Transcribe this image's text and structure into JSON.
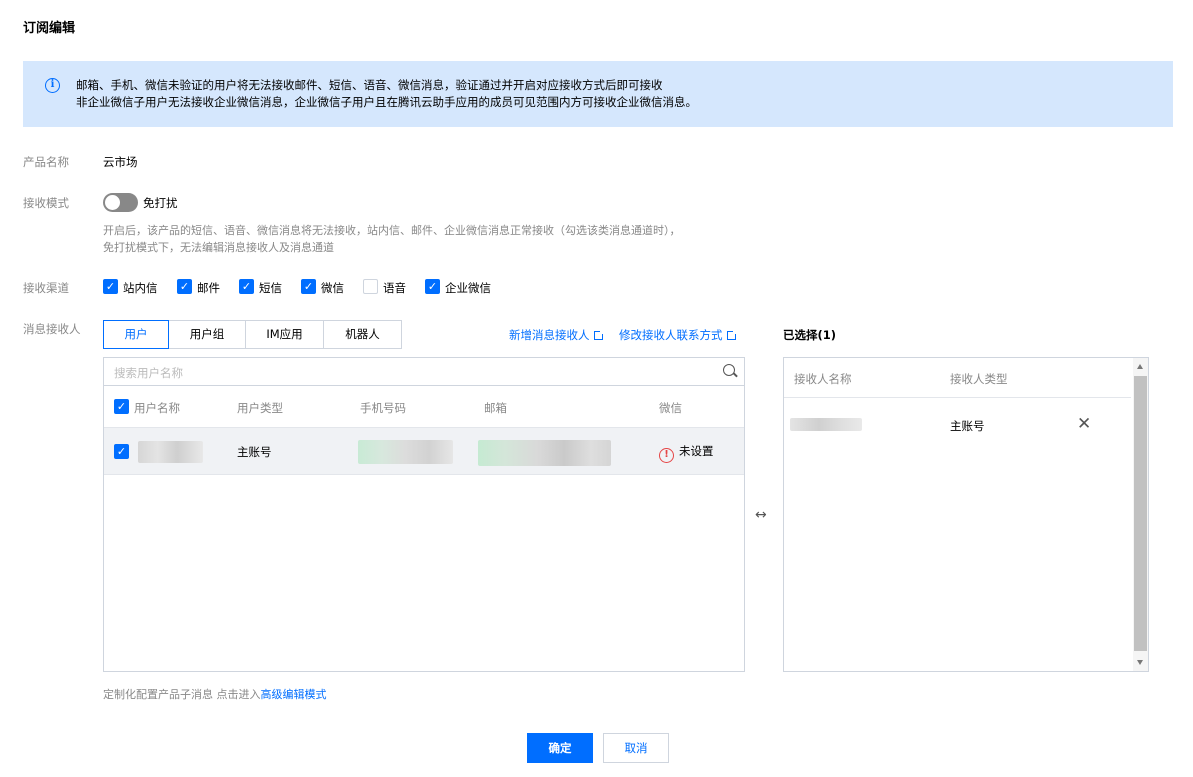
{
  "page": {
    "title": "订阅编辑"
  },
  "notice": {
    "line1": "邮箱、手机、微信未验证的用户将无法接收邮件、短信、语音、微信消息，验证通过并开启对应接收方式后即可接收",
    "line2": "非企业微信子用户无法接收企业微信消息，企业微信子用户且在腾讯云助手应用的成员可见范围内方可接收企业微信消息。"
  },
  "form": {
    "product_label": "产品名称",
    "product_value": "云市场",
    "mode_label": "接收模式",
    "mode_toggle_label": "免打扰",
    "mode_hint_1": "开启后，该产品的短信、语音、微信消息将无法接收，站内信、邮件、企业微信消息正常接收（勾选该类消息通道时），",
    "mode_hint_2": "免打扰模式下，无法编辑消息接收人及消息通道",
    "channel_label": "接收渠道",
    "channels": [
      {
        "label": "站内信",
        "checked": true
      },
      {
        "label": "邮件",
        "checked": true
      },
      {
        "label": "短信",
        "checked": true
      },
      {
        "label": "微信",
        "checked": true
      },
      {
        "label": "语音",
        "checked": false
      },
      {
        "label": "企业微信",
        "checked": true
      }
    ],
    "recipient_label": "消息接收人"
  },
  "tabs": [
    "用户",
    "用户组",
    "IM应用",
    "机器人"
  ],
  "links": {
    "add_recipient": "新增消息接收人",
    "modify_contact": "修改接收人联系方式"
  },
  "search": {
    "placeholder": "搜索用户名称"
  },
  "table": {
    "headers": [
      "用户名称",
      "用户类型",
      "手机号码",
      "邮箱",
      "微信"
    ],
    "rows": [
      {
        "type": "主账号",
        "wechat": "未设置"
      }
    ]
  },
  "selected": {
    "title": "已选择(1)",
    "headers": [
      "接收人名称",
      "接收人类型"
    ],
    "rows": [
      {
        "type": "主账号"
      }
    ]
  },
  "footer": {
    "custom_text": "定制化配置产品子消息 点击进入",
    "advanced_link": "高级编辑模式"
  },
  "buttons": {
    "confirm": "确定",
    "cancel": "取消"
  },
  "colors": {
    "accent": "#006eff",
    "notice_bg": "#d5e7fd",
    "warning": "#e54545"
  }
}
